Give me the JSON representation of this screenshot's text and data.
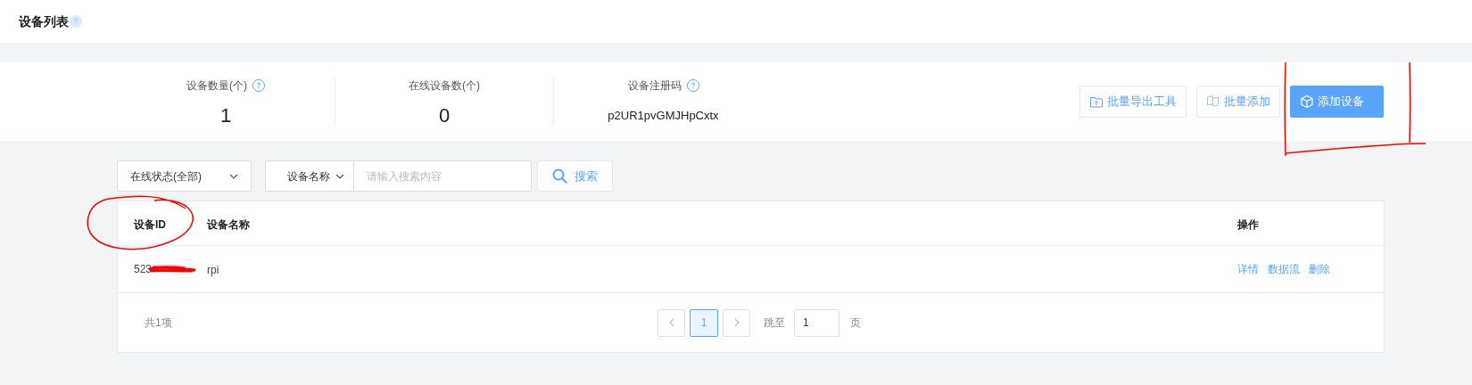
{
  "page_title": "设备列表",
  "stats": [
    {
      "label": "设备数量(个)",
      "help": true,
      "value": "1",
      "kind": "number"
    },
    {
      "label": "在线设备数(个)",
      "help": false,
      "value": "0",
      "kind": "number"
    },
    {
      "label": "设备注册码",
      "help": true,
      "value": "p2UR1pvGMJHpCxtx",
      "kind": "code"
    }
  ],
  "actions": [
    {
      "label": "批量导出工具",
      "kind": "export",
      "primary": false
    },
    {
      "label": "批量添加",
      "kind": "batch",
      "primary": false
    },
    {
      "label": "添加设备",
      "kind": "add",
      "primary": true,
      "boxed": true
    }
  ],
  "filters": {
    "status_select": "在线状态(全部)",
    "field_select": "设备名称",
    "search": {
      "placeholder": "请输入搜索内容"
    },
    "search_button": "搜索"
  },
  "table": {
    "columns": [
      {
        "label": "设备ID",
        "circled": true
      },
      {
        "label": "设备名称",
        "circled": false
      },
      {
        "label": "操作",
        "circled": false
      }
    ],
    "rows": [
      {
        "id": "523",
        "redacted": true,
        "name": "rpi",
        "actions": [
          "详情",
          "数据流",
          "删除"
        ]
      }
    ]
  },
  "pagination": {
    "total": "共1项",
    "pages": [
      {
        "label": "1",
        "selected": true
      }
    ],
    "jump_label": "跳至",
    "jump_value": "1",
    "page_suffix": "页"
  }
}
